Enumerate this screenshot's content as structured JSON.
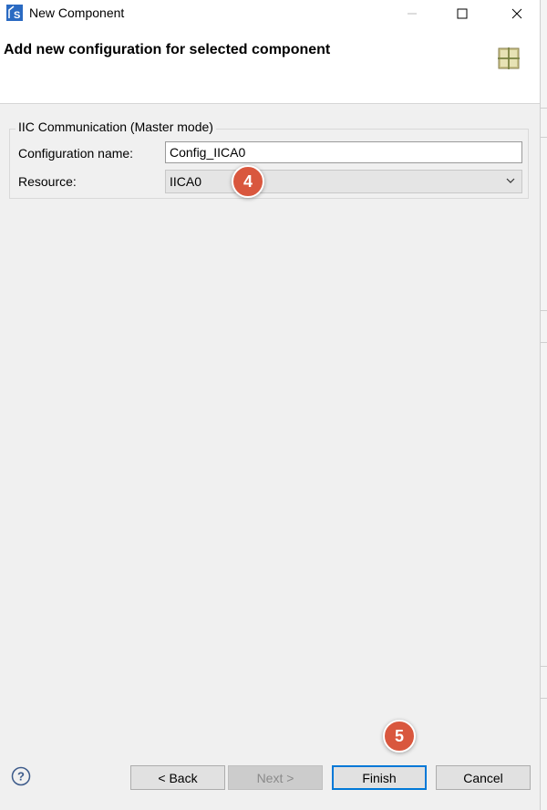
{
  "window": {
    "title": "New Component"
  },
  "header": {
    "title": "Add new configuration for selected component"
  },
  "group": {
    "legend": "IIC Communication (Master mode)",
    "configuration_name_label": "Configuration name:",
    "configuration_name_value": "Config_IICA0",
    "resource_label": "Resource:",
    "resource_value": "IICA0"
  },
  "buttons": {
    "back": "< Back",
    "next": "Next >",
    "finish": "Finish",
    "cancel": "Cancel"
  },
  "markers": {
    "step4": "4",
    "step5": "5"
  },
  "colors": {
    "marker": "#d9573e",
    "default_button_border": "#0078d7",
    "dialog_background": "#f0f0f0"
  },
  "icons": {
    "app": "renesas-s-icon",
    "header": "component-grid-icon",
    "help": "help-circle-icon",
    "dropdown": "chevron-down-icon"
  }
}
